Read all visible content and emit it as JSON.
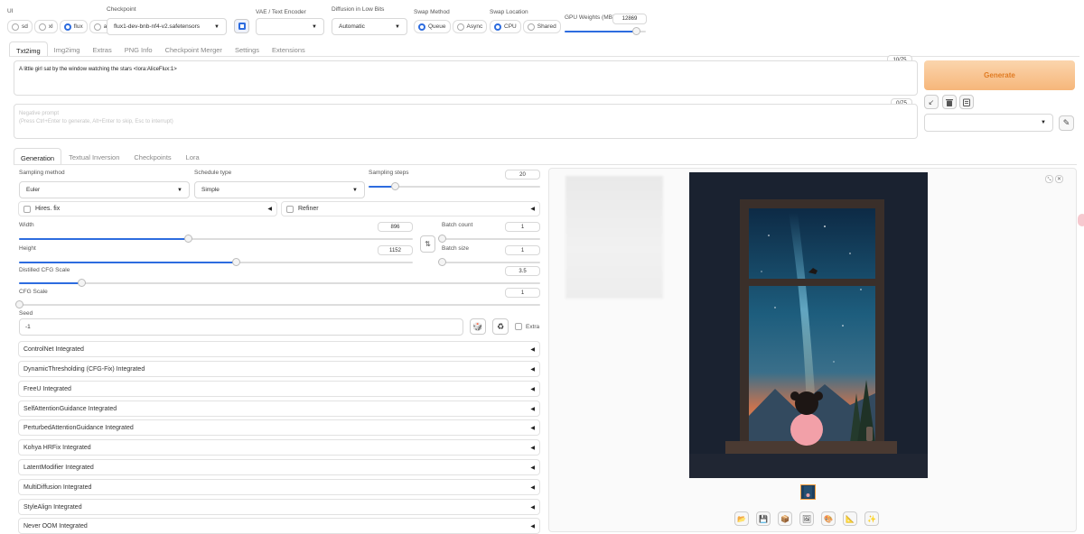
{
  "ui_selector": {
    "label": "UI",
    "options": [
      {
        "label": "sd",
        "selected": false
      },
      {
        "label": "xl",
        "selected": false
      },
      {
        "label": "flux",
        "selected": true
      },
      {
        "label": "all",
        "selected": false
      }
    ]
  },
  "checkpoint": {
    "label": "Checkpoint",
    "value": "flux1-dev-bnb-nf4-v2.safetensors"
  },
  "vae": {
    "label": "VAE / Text Encoder",
    "value": ""
  },
  "diffusion": {
    "label": "Diffusion in Low Bits",
    "value": "Automatic"
  },
  "swap_method": {
    "label": "Swap Method",
    "options": [
      {
        "label": "Queue",
        "selected": true
      },
      {
        "label": "Async",
        "selected": false
      }
    ]
  },
  "swap_location": {
    "label": "Swap Location",
    "options": [
      {
        "label": "CPU",
        "selected": true
      },
      {
        "label": "Shared",
        "selected": false
      }
    ]
  },
  "gpu_weights": {
    "label": "GPU Weights (MB)",
    "value": "12869",
    "fraction": 0.88
  },
  "main_tabs": [
    "Txt2img",
    "Img2img",
    "Extras",
    "PNG Info",
    "Checkpoint Merger",
    "Settings",
    "Extensions"
  ],
  "prompt": {
    "text": "A little girl sat by the window watching the stars <lora:AliceFlux:1>",
    "counter": "10/75"
  },
  "negative_prompt": {
    "placeholder": "Negative prompt\n(Press Ctrl+Enter to generate, Alt+Enter to skip, Esc to interrupt)",
    "counter": "0/75"
  },
  "generate_label": "Generate",
  "sub_tabs": [
    "Generation",
    "Textual Inversion",
    "Checkpoints",
    "Lora"
  ],
  "sampling_method": {
    "label": "Sampling method",
    "value": "Euler"
  },
  "schedule_type": {
    "label": "Schedule type",
    "value": "Simple"
  },
  "sampling_steps": {
    "label": "Sampling steps",
    "value": "20",
    "fraction": 0.15
  },
  "hires_fix": {
    "label": "Hires. fix"
  },
  "refiner": {
    "label": "Refiner"
  },
  "width": {
    "label": "Width",
    "value": "896",
    "fraction": 0.43
  },
  "height": {
    "label": "Height",
    "value": "1152",
    "fraction": 0.55
  },
  "batch_count": {
    "label": "Batch count",
    "value": "1",
    "fraction": 0.0
  },
  "batch_size": {
    "label": "Batch size",
    "value": "1",
    "fraction": 0.0
  },
  "distilled_cfg": {
    "label": "Distilled CFG Scale",
    "value": "3.5",
    "fraction": 0.12
  },
  "cfg_scale": {
    "label": "CFG Scale",
    "value": "1",
    "fraction": 0.0
  },
  "seed": {
    "label": "Seed",
    "value": "-1",
    "extra_label": "Extra"
  },
  "accordions": [
    "ControlNet Integrated",
    "DynamicThresholding (CFG-Fix) Integrated",
    "FreeU Integrated",
    "SelfAttentionGuidance Integrated",
    "PerturbedAttentionGuidance Integrated",
    "Kohya HRFix Integrated",
    "LatentModifier Integrated",
    "MultiDiffusion Integrated",
    "StyleAlign Integrated",
    "Never OOM Integrated"
  ],
  "colors": {
    "accent": "#2d6cdf",
    "generate_from": "#fbd5ad",
    "generate_to": "#f6b67a",
    "generate_text": "#e07b22"
  }
}
